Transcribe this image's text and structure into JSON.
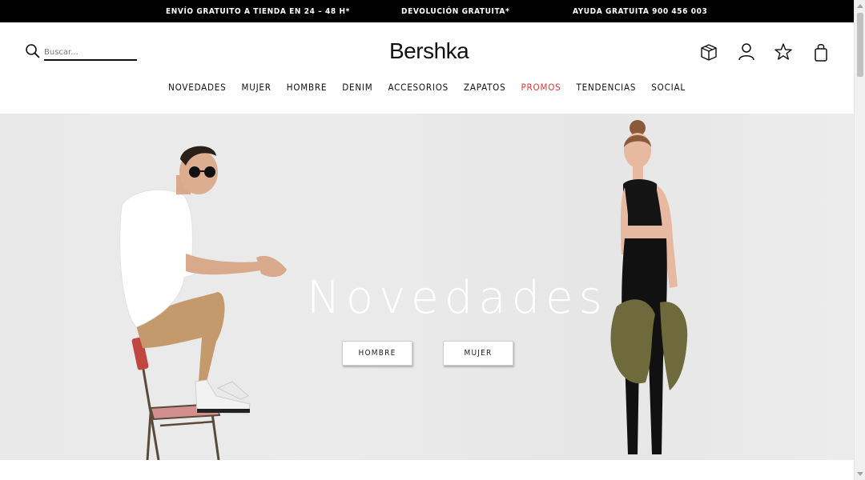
{
  "promo_bar": {
    "shipping": "ENVÍO GRATUITO A TIENDA EN 24 – 48 H*",
    "returns": "DEVOLUCIÓN GRATUITA*",
    "help": "AYUDA GRATUITA 900 456 003"
  },
  "header": {
    "logo": "Bershka",
    "search": {
      "placeholder": "Buscar...",
      "value": ""
    },
    "icons": [
      "box-icon",
      "user-icon",
      "star-icon",
      "bag-icon"
    ]
  },
  "nav": {
    "items": [
      {
        "label": "NOVEDADES"
      },
      {
        "label": "MUJER"
      },
      {
        "label": "HOMBRE"
      },
      {
        "label": "DENIM"
      },
      {
        "label": "ACCESORIOS"
      },
      {
        "label": "ZAPATOS"
      },
      {
        "label": "PROMOS"
      },
      {
        "label": "TENDENCIAS"
      },
      {
        "label": "SOCIAL"
      }
    ],
    "promo_color": "#e03b3b"
  },
  "hero": {
    "title": "Novedades",
    "buttons": {
      "men": "HOMBRE",
      "women": "MUJER"
    },
    "background": "#e9e9e9"
  }
}
